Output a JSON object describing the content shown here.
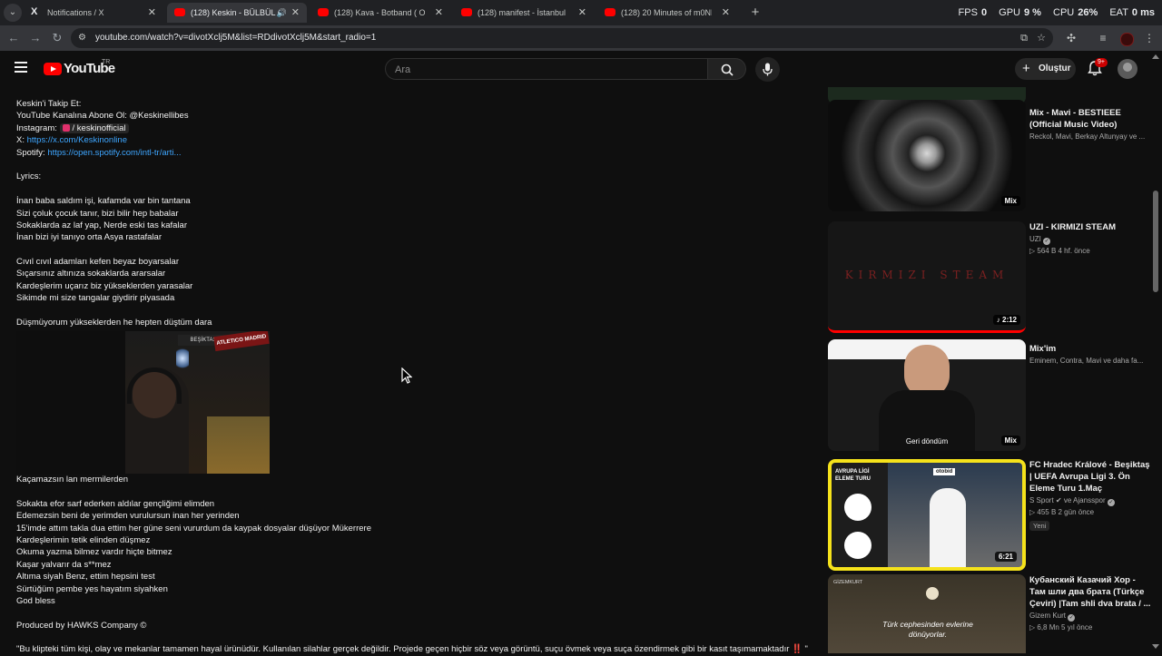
{
  "browser": {
    "tabs": [
      {
        "title": "Notifications / X",
        "favicon": "x-logo-icon",
        "active": false
      },
      {
        "title": "(128) Keskin - BÜLBÜL (Offic",
        "favicon": "youtube-icon",
        "active": true,
        "audio": true
      },
      {
        "title": "(128) Kava - Botband ( Official M",
        "favicon": "youtube-icon",
        "active": false
      },
      {
        "title": "(128) manifest - İstanbul Manife",
        "favicon": "youtube-icon",
        "active": false
      },
      {
        "title": "(128) 20 Minutes of m0NESY AW",
        "favicon": "youtube-icon",
        "active": false
      }
    ],
    "perf": {
      "fps_label": "FPS",
      "fps": "0",
      "gpu_label": "GPU",
      "gpu": "9 %",
      "cpu_label": "CPU",
      "cpu": "26%",
      "extra_label": "EAT",
      "extra": "0 ms"
    },
    "url": "youtube.com/watch?v=divotXclj5M&list=RDdivotXclj5M&start_radio=1"
  },
  "youtube": {
    "logo_text": "YouTube",
    "country_code": "TR",
    "search_placeholder": "Ara",
    "create_label": "Oluştur",
    "notification_count": "9+"
  },
  "description": {
    "lines": [
      {
        "text": "Keskin'i Takip Et:"
      },
      {
        "text": "YouTube Kanalına Abone Ol: @Keskinellibes"
      },
      {
        "prefix": "Instagram: ",
        "chip": "/ keskinofficial"
      },
      {
        "prefix": "X: ",
        "link": "https://x.com/Keskinonline"
      },
      {
        "prefix": "Spotify: ",
        "link": "https://open.spotify.com/intl-tr/arti..."
      },
      {
        "gap": true
      },
      {
        "text": "Lyrics:"
      },
      {
        "gap": true
      },
      {
        "text": "İnan baba saldım işi, kafamda var bin tantana"
      },
      {
        "text": "Sizi çoluk çocuk tanır, bizi bilir hep babalar"
      },
      {
        "text": "Sokaklarda az laf yap, Nerde eski tas kafalar"
      },
      {
        "text": "İnan bizi iyi tanıyo orta Asya rastafalar"
      },
      {
        "gap": true
      },
      {
        "text": "Cıvıl cıvıl adamları kefen beyaz boyarsalar"
      },
      {
        "text": "Sıçarsınız altınıza sokaklarda ararsalar"
      },
      {
        "text": "Kardeşlerim uçarız biz yükseklerden yarasalar"
      },
      {
        "text": "Sikimde mi size tangalar giydirir piyasada"
      },
      {
        "gap": true
      },
      {
        "text": "Düşmüyorum yükseklerden he hepten düştüm dara"
      }
    ],
    "lines2": [
      {
        "text": "Kaçamazsın lan mermilerden"
      },
      {
        "gap": true
      },
      {
        "text": "Sokakta efor sarf ederken aldılar gençliğimi elimden"
      },
      {
        "text": "Edemezsin beni de yerimden vurulursun inan her yerinden"
      },
      {
        "text": "15'imde attım takla dua ettim her güne seni vururdum da kaypak dosyalar düşüyor Mükerrere"
      },
      {
        "text": "Kardeşlerimin tetik elinden düşmez"
      },
      {
        "text": "Okuma yazma bilmez vardır hiçte bitmez"
      },
      {
        "text": "Kaşar yalvarır da s**mez"
      },
      {
        "text": "Altıma siyah Benz, ettim hepsini test"
      },
      {
        "text": "Sürtüğüm pembe yes hayatım siyahken"
      },
      {
        "text": "God bless"
      },
      {
        "gap": true
      },
      {
        "text": "Produced by HAWKS Company ©"
      },
      {
        "gap": true
      },
      {
        "text": "\"Bu klipteki tüm kişi, olay ve mekanlar tamamen hayal ürünüdür. Kullanılan silahlar gerçek değildir. Projede geçen hiçbir söz veya görüntü, suçu övmek veya suça özendirmek gibi bir kasıt taşımamaktadır ‼️ \""
      }
    ]
  },
  "webcam": {
    "banner_text": "BEŞİKTAŞ",
    "poster_text": "ATLETICO MADRID"
  },
  "sidebar": {
    "items": [
      {
        "title": "Mix - Mavi - BESTIEEE (Official Music Video)",
        "channel": "Reckol, Mavi, Berkay Altunyay ve ...",
        "stats": "",
        "badge": "Mix"
      },
      {
        "title": "UZI - KIRMIZI STEAM",
        "channel": "UZI",
        "verified": true,
        "stats": "▷ 564 B   4 hf. önce",
        "badge": "♪ 2:12",
        "thumb_text": "KIRMIZI STEAM"
      },
      {
        "title": "Mix'im",
        "channel": "Eminem, Contra, Mavi ve daha fa...",
        "stats": "",
        "badge": "Mix",
        "thumb_caption": "Geri döndüm"
      },
      {
        "title": "FC Hradec Králové - Beşiktaş | UEFA Avrupa Ligi 3. Ön Eleme Turu 1.Maç",
        "channel": "S Sport ✔ ve Ajansspor",
        "verified": true,
        "stats": "▷ 455 B   2 gün önce",
        "badge": "6:21",
        "new_label": "Yeni",
        "thumb_text": "AVRUPA LİGİ ELEME TURU",
        "thumb_brand": "otobid"
      },
      {
        "title": "Кубанский Казачий Хор - Там шли два брата (Türkçe Çeviri) |Tam shli dva brata / ...",
        "channel": "Gizem Kurt",
        "verified": true,
        "stats": "▷ 6,8 Mn   5 yıl önce",
        "thumb_text": "Türk cephesinden evlerine dönüyorlar.",
        "thumb_brand": "GİZEMKURT"
      }
    ]
  },
  "colors": {
    "background": "#0f0f0f",
    "link": "#3ea6ff",
    "youtube_red": "#ff0000",
    "highlight_yellow": "#f5e21b"
  }
}
